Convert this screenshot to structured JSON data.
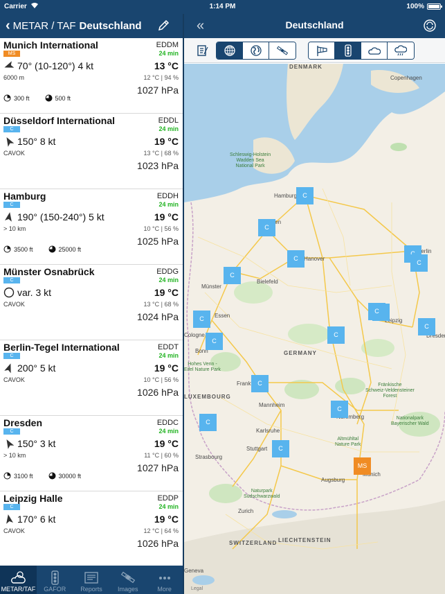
{
  "status": {
    "carrier": "Carrier",
    "time": "1:14 PM",
    "battery": "100%"
  },
  "nav_left": {
    "back_label": "METAR / TAF",
    "title": "Deutschland"
  },
  "nav_right": {
    "title": "Deutschland"
  },
  "stations": [
    {
      "name": "Munich International",
      "icao": "EDDM",
      "badge": "MS",
      "badge_color": "#f08c24",
      "age": "24 min",
      "wind": "70° (10-120°) 4 kt",
      "wind_dir": 70,
      "wind_icon": "wind-arrow",
      "temp": "13 °C",
      "vis": "6000 m",
      "humid": "12 °C | 94 %",
      "qnh": "1027 hPa",
      "clouds": [
        {
          "icon": "cloud-scattered-icon",
          "text": "300 ft"
        },
        {
          "icon": "cloud-broken-icon",
          "text": "500 ft"
        }
      ]
    },
    {
      "name": "Düsseldorf International",
      "icao": "EDDL",
      "badge": "C",
      "badge_color": "#58b4ee",
      "age": "24 min",
      "wind": "150° 8 kt",
      "wind_dir": 150,
      "wind_icon": "wind-arrow",
      "temp": "19 °C",
      "vis": "CAVOK",
      "humid": "13 °C | 68 %",
      "qnh": "1023 hPa",
      "clouds": []
    },
    {
      "name": "Hamburg",
      "icao": "EDDH",
      "badge": "C",
      "badge_color": "#58b4ee",
      "age": "24 min",
      "wind": "190° (150-240°) 5 kt",
      "wind_dir": 190,
      "wind_icon": "wind-arrow",
      "temp": "19 °C",
      "vis": "> 10 km",
      "humid": "10 °C | 56 %",
      "qnh": "1025 hPa",
      "clouds": [
        {
          "icon": "cloud-scattered-icon",
          "text": "3500 ft"
        },
        {
          "icon": "cloud-broken-icon",
          "text": "25000 ft"
        }
      ]
    },
    {
      "name": "Münster Osnabrück",
      "icao": "EDDG",
      "badge": "C",
      "badge_color": "#58b4ee",
      "age": "24 min",
      "wind": "var. 3 kt",
      "wind_dir": null,
      "wind_icon": "wind-variable-circle",
      "temp": "19 °C",
      "vis": "CAVOK",
      "humid": "13 °C | 68 %",
      "qnh": "1024 hPa",
      "clouds": []
    },
    {
      "name": "Berlin-Tegel International",
      "icao": "EDDT",
      "badge": "C",
      "badge_color": "#58b4ee",
      "age": "24 min",
      "wind": "200° 5 kt",
      "wind_dir": 200,
      "wind_icon": "wind-arrow",
      "temp": "19 °C",
      "vis": "CAVOK",
      "humid": "10 °C | 56 %",
      "qnh": "1026 hPa",
      "clouds": []
    },
    {
      "name": "Dresden",
      "icao": "EDDC",
      "badge": "C",
      "badge_color": "#58b4ee",
      "age": "24 min",
      "wind": "150° 3 kt",
      "wind_dir": 150,
      "wind_icon": "wind-arrow",
      "temp": "19 °C",
      "vis": "> 10 km",
      "humid": "11 °C | 60 %",
      "qnh": "1027 hPa",
      "clouds": [
        {
          "icon": "cloud-scattered-icon",
          "text": "3100 ft"
        },
        {
          "icon": "cloud-broken-icon",
          "text": "30000 ft"
        }
      ]
    },
    {
      "name": "Leipzig Halle",
      "icao": "EDDP",
      "badge": "C",
      "badge_color": "#58b4ee",
      "age": "24 min",
      "wind": "170° 6 kt",
      "wind_dir": 170,
      "wind_icon": "wind-arrow",
      "temp": "19 °C",
      "vis": "CAVOK",
      "humid": "12 °C | 64 %",
      "qnh": "1026 hPa",
      "clouds": []
    }
  ],
  "tabs": [
    {
      "label": "METAR/TAF",
      "icon": "weather-cloud-sun-icon",
      "active": true
    },
    {
      "label": "GAFOR",
      "icon": "traffic-light-icon",
      "active": false
    },
    {
      "label": "Reports",
      "icon": "newspaper-icon",
      "active": false
    },
    {
      "label": "Images",
      "icon": "satellite-icon",
      "active": false
    },
    {
      "label": "More",
      "icon": "more-dots-icon",
      "active": false
    }
  ],
  "map_tools": {
    "notes_icon": "notes-icon",
    "source_segments": [
      {
        "icon": "globe-grid-icon",
        "selected": true
      },
      {
        "icon": "globe-icon",
        "selected": false
      },
      {
        "icon": "satellite-icon",
        "selected": false
      }
    ],
    "layer_segments": [
      {
        "icon": "windsock-icon",
        "selected": false
      },
      {
        "icon": "traffic-light-icon",
        "selected": true
      },
      {
        "icon": "cloud-icon",
        "selected": false
      },
      {
        "icon": "rain-cloud-icon",
        "selected": false
      }
    ]
  },
  "map": {
    "labels": [
      {
        "text": "DENMARK",
        "kind": "country"
      },
      {
        "text": "Copenhagen",
        "kind": "city"
      },
      {
        "text": "Schleswig-Holstein\nWadden Sea\nNational Park",
        "kind": "park"
      },
      {
        "text": "Hamburg",
        "kind": "city"
      },
      {
        "text": "Bremen",
        "kind": "city"
      },
      {
        "text": "Hanover",
        "kind": "city"
      },
      {
        "text": "Berlin",
        "kind": "city"
      },
      {
        "text": "Bielefeld",
        "kind": "city"
      },
      {
        "text": "Münster",
        "kind": "city"
      },
      {
        "text": "Essen",
        "kind": "city"
      },
      {
        "text": "Cologne",
        "kind": "city"
      },
      {
        "text": "Bonn",
        "kind": "city"
      },
      {
        "text": "Leipzig",
        "kind": "city"
      },
      {
        "text": "Dresden",
        "kind": "city"
      },
      {
        "text": "GERMANY",
        "kind": "country"
      },
      {
        "text": "Hohes Venn -\nEifel Nature Park",
        "kind": "park"
      },
      {
        "text": "Frankfurt",
        "kind": "city"
      },
      {
        "text": "Fränkische\nSchweiz-Veldensteiner\nForest",
        "kind": "park"
      },
      {
        "text": "LUXEMBOURG",
        "kind": "country"
      },
      {
        "text": "Mannheim",
        "kind": "city"
      },
      {
        "text": "Nuremberg",
        "kind": "city"
      },
      {
        "text": "Nationalpark\nBayerischer Wald",
        "kind": "park"
      },
      {
        "text": "Karlsruhe",
        "kind": "city"
      },
      {
        "text": "Altmühltal\nNature Park",
        "kind": "park"
      },
      {
        "text": "Strasbourg",
        "kind": "city"
      },
      {
        "text": "Stuttgart",
        "kind": "city"
      },
      {
        "text": "Augsburg",
        "kind": "city"
      },
      {
        "text": "Munich",
        "kind": "city"
      },
      {
        "text": "Naturpark\nSüdschwarzwald",
        "kind": "park"
      },
      {
        "text": "Zurich",
        "kind": "city"
      },
      {
        "text": "LIECHTENSTEIN",
        "kind": "country"
      },
      {
        "text": "SWITZERLAND",
        "kind": "country"
      },
      {
        "text": "Geneva",
        "kind": "city"
      }
    ],
    "markers": [
      {
        "label": "C",
        "station": "Hamburg"
      },
      {
        "label": "C",
        "station": "Bremen"
      },
      {
        "label": "C",
        "station": "Hanover"
      },
      {
        "label": "C",
        "station": "Berlin Tegel"
      },
      {
        "label": "C",
        "station": "Berlin Schönefeld"
      },
      {
        "label": "C",
        "station": "Münster Osnabrück"
      },
      {
        "label": "C",
        "station": "Düsseldorf"
      },
      {
        "label": "C",
        "station": "Cologne Bonn"
      },
      {
        "label": "C",
        "station": "Paderborn"
      },
      {
        "label": "C",
        "station": "Leipzig Halle"
      },
      {
        "label": "C",
        "station": "Erfurt"
      },
      {
        "label": "C",
        "station": "Dresden"
      },
      {
        "label": "C",
        "station": "Frankfurt"
      },
      {
        "label": "C",
        "station": "Nuremberg"
      },
      {
        "label": "C",
        "station": "Saarbrücken"
      },
      {
        "label": "C",
        "station": "Stuttgart"
      },
      {
        "label": "MS",
        "station": "Munich"
      }
    ],
    "legal": "Legal"
  }
}
